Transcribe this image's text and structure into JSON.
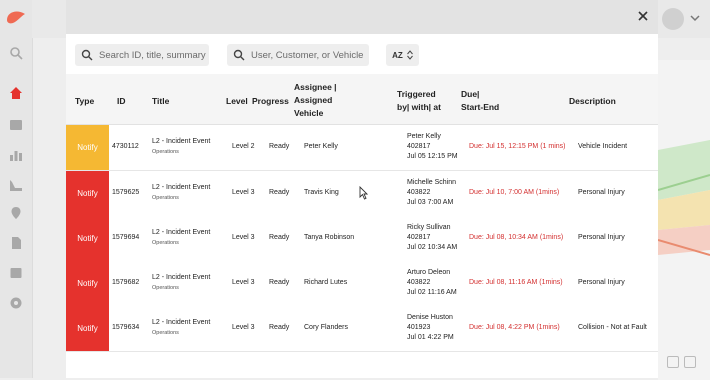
{
  "search": {
    "id_placeholder": "Search ID, title, summary",
    "user_placeholder": "User, Customer, or Vehicle",
    "sort_label": "AZ"
  },
  "table": {
    "headers": {
      "type": "Type",
      "id": "ID",
      "title": "Title",
      "level": "Level",
      "progress": "Progress",
      "assignee_1": "Assignee |",
      "assignee_2": "Assigned",
      "assignee_3": "Vehicle",
      "triggered_1": "Triggered",
      "triggered_2": "by| with| at",
      "due_1": "Due|",
      "due_2": "Start-End",
      "description": "Description"
    },
    "rows": [
      {
        "type": "Notify",
        "type_color": "#f5b833",
        "id": "4730112",
        "title": "L2 - Incident Event",
        "subtitle": "Operations",
        "level": "Level 2",
        "progress": "Ready",
        "assignee": "Peter Kelly",
        "trig_name": "Peter Kelly",
        "trig_num": "402817",
        "trig_time": "Jul 05 12:15 PM",
        "due": "Due: Jul 15, 12:15 PM (1 mins)",
        "description": "Vehicle Incident"
      },
      {
        "type": "Notify",
        "type_color": "#e5322d",
        "id": "1579625",
        "title": "L2 - Incident Event",
        "subtitle": "Operations",
        "level": "Level 3",
        "progress": "Ready",
        "assignee": "Travis King",
        "trig_name": "Michelle Schinn",
        "trig_num": "403822",
        "trig_time": "Jul 03 7:00 AM",
        "due": "Due: Jul 10, 7:00 AM (1mins)",
        "description": "Personal Injury"
      },
      {
        "type": "Notify",
        "type_color": "#e5322d",
        "id": "1579694",
        "title": "L2 - Incident Event",
        "subtitle": "Operations",
        "level": "Level 3",
        "progress": "Ready",
        "assignee": "Tanya Robinson",
        "trig_name": "Ricky Sullivan",
        "trig_num": "402817",
        "trig_time": "Jul 02 10:34 AM",
        "due": "Due: Jul 08, 10:34 AM (1mins)",
        "description": "Personal Injury"
      },
      {
        "type": "Notify",
        "type_color": "#e5322d",
        "id": "1579682",
        "title": "L2 - Incident Event",
        "subtitle": "Operations",
        "level": "Level 3",
        "progress": "Ready",
        "assignee": "Richard Lutes",
        "trig_name": "Arturo Deleon",
        "trig_num": "403822",
        "trig_time": "Jul 02 11:16 AM",
        "due": "Due: Jul 08, 11:16 AM (1mins)",
        "description": "Personal Injury"
      },
      {
        "type": "Notify",
        "type_color": "#e5322d",
        "id": "1579634",
        "title": "L2 - Incident Event",
        "subtitle": "Operations",
        "level": "Level 3",
        "progress": "Ready",
        "assignee": "Cory Flanders",
        "trig_name": "Denise Huston",
        "trig_num": "401923",
        "trig_time": "Jul 01 4:22 PM",
        "due": "Due: Jul 08, 4:22 PM (1mins)",
        "description": "Collision - Not at Fault"
      }
    ]
  },
  "colors": {
    "notify_warning": "#f5b833",
    "notify_critical": "#e5322d",
    "due_text": "#d32f2f"
  }
}
